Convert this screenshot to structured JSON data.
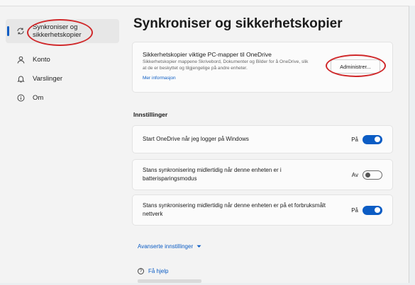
{
  "sidebar": {
    "items": [
      {
        "label": "Synkroniser og sikkerhetskopier",
        "icon": "sync-icon",
        "active": true
      },
      {
        "label": "Konto",
        "icon": "person-icon"
      },
      {
        "label": "Varslinger",
        "icon": "bell-icon"
      },
      {
        "label": "Om",
        "icon": "info-icon"
      }
    ]
  },
  "main": {
    "title": "Synkroniser og sikkerhetskopier",
    "backup": {
      "title": "Sikkerhetskopier viktige PC-mapper til OneDrive",
      "description": "Sikkerhetskopier mappene Skrivebord, Dokumenter og Bilder for å OneDrive, slik at de er beskyttet og tilgjengelige på andre enheter.",
      "link": "Mer informasjon",
      "button": "Administrer..."
    },
    "section_title": "Innstillinger",
    "settings": [
      {
        "label": "Start OneDrive når jeg logger på Windows",
        "state": "På",
        "on": true
      },
      {
        "label": "Stans synkronisering midlertidig når denne enheten er i batterisparingsmodus",
        "state": "Av",
        "on": false
      },
      {
        "label": "Stans synkronisering midlertidig når denne enheten er på et forbruksmålt nettverk",
        "state": "På",
        "on": true
      }
    ],
    "advanced": "Avanserte innstillinger",
    "help": "Få hjelp"
  },
  "colors": {
    "accent": "#0b5cc4",
    "annotation": "#d0282a"
  }
}
